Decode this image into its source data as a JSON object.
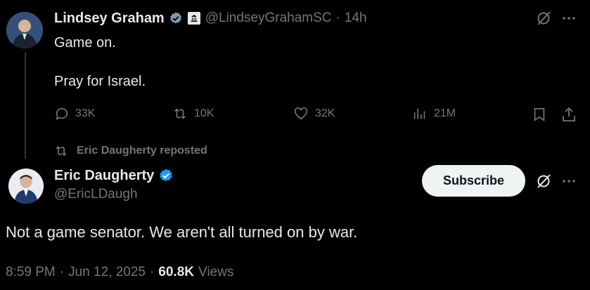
{
  "tweet1": {
    "name": "Lindsey Graham",
    "handle": "@LindseyGrahamSC",
    "sep": "·",
    "time": "14h",
    "text_line1": "Game on.",
    "text_line2": "Pray for Israel.",
    "replies": "33K",
    "reposts": "10K",
    "likes": "32K",
    "views": "21M"
  },
  "repost": {
    "label": "Eric Daugherty reposted"
  },
  "tweet2": {
    "name": "Eric Daugherty",
    "handle": "@EricLDaugh",
    "subscribe_label": "Subscribe",
    "text": "Not a game senator. We aren't all turned on by war.",
    "time": "8:59 PM",
    "sep1": "·",
    "date": "Jun 12, 2025",
    "sep2": "·",
    "views_count": "60.8K",
    "views_label": "Views"
  },
  "colors": {
    "background": "#000000",
    "text": "#e7e9ea",
    "muted": "#71767b",
    "verified": "#1d9bf0"
  }
}
